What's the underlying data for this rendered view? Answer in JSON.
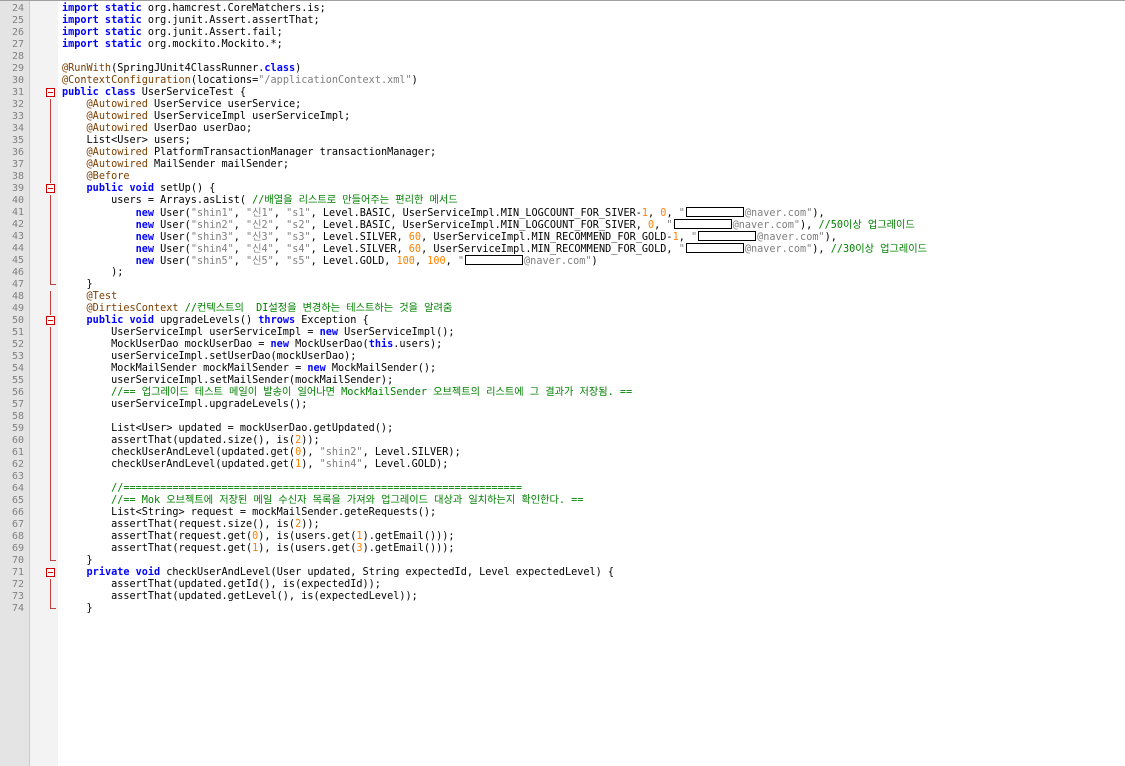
{
  "editor": {
    "lines": [
      {
        "n": "24",
        "fold": "",
        "segs": [
          {
            "t": "kw",
            "v": "import static"
          },
          {
            "t": "",
            "v": " org.hamcrest.CoreMatchers.is;"
          }
        ]
      },
      {
        "n": "25",
        "fold": "",
        "segs": [
          {
            "t": "kw",
            "v": "import static"
          },
          {
            "t": "",
            "v": " org.junit.Assert.assertThat;"
          }
        ]
      },
      {
        "n": "26",
        "fold": "",
        "segs": [
          {
            "t": "kw",
            "v": "import static"
          },
          {
            "t": "",
            "v": " org.junit.Assert.fail;"
          }
        ]
      },
      {
        "n": "27",
        "fold": "",
        "segs": [
          {
            "t": "kw",
            "v": "import static"
          },
          {
            "t": "",
            "v": " org.mockito.Mockito.*;"
          }
        ]
      },
      {
        "n": "28",
        "fold": "",
        "segs": []
      },
      {
        "n": "29",
        "fold": "",
        "segs": [
          {
            "t": "ann",
            "v": "@RunWith"
          },
          {
            "t": "",
            "v": "(SpringJUnit4ClassRunner."
          },
          {
            "t": "kw",
            "v": "class"
          },
          {
            "t": "",
            "v": ")"
          }
        ]
      },
      {
        "n": "30",
        "fold": "",
        "segs": [
          {
            "t": "ann",
            "v": "@ContextConfiguration"
          },
          {
            "t": "",
            "v": "(locations="
          },
          {
            "t": "str",
            "v": "\"/applicationContext.xml\""
          },
          {
            "t": "",
            "v": ")"
          }
        ]
      },
      {
        "n": "31",
        "fold": "box",
        "segs": [
          {
            "t": "kw",
            "v": "public class"
          },
          {
            "t": "",
            "v": " UserServiceTest {"
          }
        ]
      },
      {
        "n": "32",
        "fold": "bar",
        "segs": [
          {
            "t": "",
            "v": "    "
          },
          {
            "t": "ann",
            "v": "@Autowired"
          },
          {
            "t": "",
            "v": " UserService userService;"
          }
        ]
      },
      {
        "n": "33",
        "fold": "bar",
        "segs": [
          {
            "t": "",
            "v": "    "
          },
          {
            "t": "ann",
            "v": "@Autowired"
          },
          {
            "t": "",
            "v": " UserServiceImpl userServiceImpl;"
          }
        ]
      },
      {
        "n": "34",
        "fold": "bar",
        "segs": [
          {
            "t": "",
            "v": "    "
          },
          {
            "t": "ann",
            "v": "@Autowired"
          },
          {
            "t": "",
            "v": " UserDao userDao;"
          }
        ]
      },
      {
        "n": "35",
        "fold": "bar",
        "segs": [
          {
            "t": "",
            "v": "    List<User> users;"
          }
        ]
      },
      {
        "n": "36",
        "fold": "bar",
        "segs": [
          {
            "t": "",
            "v": "    "
          },
          {
            "t": "ann",
            "v": "@Autowired"
          },
          {
            "t": "",
            "v": " PlatformTransactionManager transactionManager;"
          }
        ]
      },
      {
        "n": "37",
        "fold": "bar",
        "segs": [
          {
            "t": "",
            "v": "    "
          },
          {
            "t": "ann",
            "v": "@Autowired"
          },
          {
            "t": "",
            "v": " MailSender mailSender;"
          }
        ]
      },
      {
        "n": "38",
        "fold": "bar",
        "segs": [
          {
            "t": "",
            "v": "    "
          },
          {
            "t": "ann",
            "v": "@Before"
          }
        ]
      },
      {
        "n": "39",
        "fold": "box",
        "segs": [
          {
            "t": "",
            "v": "    "
          },
          {
            "t": "kw",
            "v": "public void"
          },
          {
            "t": "",
            "v": " setUp() {"
          }
        ]
      },
      {
        "n": "40",
        "fold": "bar",
        "segs": [
          {
            "t": "",
            "v": "        users = Arrays.asList( "
          },
          {
            "t": "cmt",
            "v": "//배열을 리스트로 만들어주는 편리한 메서드"
          }
        ]
      },
      {
        "n": "41",
        "fold": "bar",
        "segs": [
          {
            "t": "",
            "v": "            "
          },
          {
            "t": "kw",
            "v": "new"
          },
          {
            "t": "",
            "v": " User("
          },
          {
            "t": "str",
            "v": "\"shin1\""
          },
          {
            "t": "",
            "v": ", "
          },
          {
            "t": "str",
            "v": "\"신1\""
          },
          {
            "t": "",
            "v": ", "
          },
          {
            "t": "str",
            "v": "\"s1\""
          },
          {
            "t": "",
            "v": ", Level.BASIC, UserServiceImpl.MIN_LOGCOUNT_FOR_SIVER-"
          },
          {
            "t": "num",
            "v": "1"
          },
          {
            "t": "",
            "v": ", "
          },
          {
            "t": "num",
            "v": "0"
          },
          {
            "t": "",
            "v": ", "
          },
          {
            "t": "str",
            "v": "\""
          },
          {
            "t": "redact",
            "v": ""
          },
          {
            "t": "str",
            "v": "@naver.com\""
          },
          {
            "t": "",
            "v": "),"
          }
        ]
      },
      {
        "n": "42",
        "fold": "bar",
        "segs": [
          {
            "t": "",
            "v": "            "
          },
          {
            "t": "kw",
            "v": "new"
          },
          {
            "t": "",
            "v": " User("
          },
          {
            "t": "str",
            "v": "\"shin2\""
          },
          {
            "t": "",
            "v": ", "
          },
          {
            "t": "str",
            "v": "\"신2\""
          },
          {
            "t": "",
            "v": ", "
          },
          {
            "t": "str",
            "v": "\"s2\""
          },
          {
            "t": "",
            "v": ", Level.BASIC, UserServiceImpl.MIN_LOGCOUNT_FOR_SIVER, "
          },
          {
            "t": "num",
            "v": "0"
          },
          {
            "t": "",
            "v": ", "
          },
          {
            "t": "str",
            "v": "\""
          },
          {
            "t": "redact",
            "v": ""
          },
          {
            "t": "str",
            "v": "@naver.com\""
          },
          {
            "t": "",
            "v": "), "
          },
          {
            "t": "cmt",
            "v": "//50이상 업그레이드"
          }
        ]
      },
      {
        "n": "43",
        "fold": "bar",
        "segs": [
          {
            "t": "",
            "v": "            "
          },
          {
            "t": "kw",
            "v": "new"
          },
          {
            "t": "",
            "v": " User("
          },
          {
            "t": "str",
            "v": "\"shin3\""
          },
          {
            "t": "",
            "v": ", "
          },
          {
            "t": "str",
            "v": "\"신3\""
          },
          {
            "t": "",
            "v": ", "
          },
          {
            "t": "str",
            "v": "\"s3\""
          },
          {
            "t": "",
            "v": ", Level.SILVER, "
          },
          {
            "t": "num",
            "v": "60"
          },
          {
            "t": "",
            "v": ", UserServiceImpl.MIN_RECOMMEND_FOR_GOLD-"
          },
          {
            "t": "num",
            "v": "1"
          },
          {
            "t": "",
            "v": ", "
          },
          {
            "t": "str",
            "v": "\""
          },
          {
            "t": "redact",
            "v": ""
          },
          {
            "t": "str",
            "v": "@naver.com\""
          },
          {
            "t": "",
            "v": "),"
          }
        ]
      },
      {
        "n": "44",
        "fold": "bar",
        "segs": [
          {
            "t": "",
            "v": "            "
          },
          {
            "t": "kw",
            "v": "new"
          },
          {
            "t": "",
            "v": " User("
          },
          {
            "t": "str",
            "v": "\"shin4\""
          },
          {
            "t": "",
            "v": ", "
          },
          {
            "t": "str",
            "v": "\"신4\""
          },
          {
            "t": "",
            "v": ", "
          },
          {
            "t": "str",
            "v": "\"s4\""
          },
          {
            "t": "",
            "v": ", Level.SILVER, "
          },
          {
            "t": "num",
            "v": "60"
          },
          {
            "t": "",
            "v": ", UserServiceImpl.MIN_RECOMMEND_FOR_GOLD, "
          },
          {
            "t": "str",
            "v": "\""
          },
          {
            "t": "redact",
            "v": ""
          },
          {
            "t": "str",
            "v": "@naver.com\""
          },
          {
            "t": "",
            "v": "), "
          },
          {
            "t": "cmt",
            "v": "//30이상 업그레이드"
          }
        ]
      },
      {
        "n": "45",
        "fold": "bar",
        "segs": [
          {
            "t": "",
            "v": "            "
          },
          {
            "t": "kw",
            "v": "new"
          },
          {
            "t": "",
            "v": " User("
          },
          {
            "t": "str",
            "v": "\"shin5\""
          },
          {
            "t": "",
            "v": ", "
          },
          {
            "t": "str",
            "v": "\"신5\""
          },
          {
            "t": "",
            "v": ", "
          },
          {
            "t": "str",
            "v": "\"s5\""
          },
          {
            "t": "",
            "v": ", Level.GOLD, "
          },
          {
            "t": "num",
            "v": "100"
          },
          {
            "t": "",
            "v": ", "
          },
          {
            "t": "num",
            "v": "100"
          },
          {
            "t": "",
            "v": ", "
          },
          {
            "t": "str",
            "v": "\""
          },
          {
            "t": "redact",
            "v": ""
          },
          {
            "t": "str",
            "v": "@naver.com\""
          },
          {
            "t": "",
            "v": ")"
          }
        ]
      },
      {
        "n": "46",
        "fold": "bar",
        "segs": [
          {
            "t": "",
            "v": "        );"
          }
        ]
      },
      {
        "n": "47",
        "fold": "end",
        "segs": [
          {
            "t": "",
            "v": "    }"
          }
        ]
      },
      {
        "n": "48",
        "fold": "bar",
        "segs": [
          {
            "t": "",
            "v": "    "
          },
          {
            "t": "ann",
            "v": "@Test"
          }
        ]
      },
      {
        "n": "49",
        "fold": "bar",
        "segs": [
          {
            "t": "",
            "v": "    "
          },
          {
            "t": "ann",
            "v": "@DirtiesContext"
          },
          {
            "t": "",
            "v": " "
          },
          {
            "t": "cmt",
            "v": "//컨텍스트의  DI설정을 변경하는 테스트하는 것을 알려줌"
          }
        ]
      },
      {
        "n": "50",
        "fold": "box",
        "segs": [
          {
            "t": "",
            "v": "    "
          },
          {
            "t": "kw",
            "v": "public void"
          },
          {
            "t": "",
            "v": " upgradeLevels() "
          },
          {
            "t": "kw",
            "v": "throws"
          },
          {
            "t": "",
            "v": " Exception {"
          }
        ]
      },
      {
        "n": "51",
        "fold": "bar",
        "segs": [
          {
            "t": "",
            "v": "        UserServiceImpl userServiceImpl = "
          },
          {
            "t": "kw",
            "v": "new"
          },
          {
            "t": "",
            "v": " UserServiceImpl();"
          }
        ]
      },
      {
        "n": "52",
        "fold": "bar",
        "segs": [
          {
            "t": "",
            "v": "        MockUserDao mockUserDao = "
          },
          {
            "t": "kw",
            "v": "new"
          },
          {
            "t": "",
            "v": " MockUserDao("
          },
          {
            "t": "kw",
            "v": "this"
          },
          {
            "t": "",
            "v": ".users);"
          }
        ]
      },
      {
        "n": "53",
        "fold": "bar",
        "segs": [
          {
            "t": "",
            "v": "        userServiceImpl.setUserDao(mockUserDao);"
          }
        ]
      },
      {
        "n": "54",
        "fold": "bar",
        "segs": [
          {
            "t": "",
            "v": "        MockMailSender mockMailSender = "
          },
          {
            "t": "kw",
            "v": "new"
          },
          {
            "t": "",
            "v": " MockMailSender();"
          }
        ]
      },
      {
        "n": "55",
        "fold": "bar",
        "segs": [
          {
            "t": "",
            "v": "        userServiceImpl.setMailSender(mockMailSender);"
          }
        ]
      },
      {
        "n": "56",
        "fold": "bar",
        "segs": [
          {
            "t": "",
            "v": "        "
          },
          {
            "t": "cmt",
            "v": "//== 업그레이드 테스트 메일이 발송이 일어나면 MockMailSender 오브젝트의 리스트에 그 결과가 저장됨. =="
          }
        ]
      },
      {
        "n": "57",
        "fold": "bar",
        "segs": [
          {
            "t": "",
            "v": "        userServiceImpl.upgradeLevels();"
          }
        ]
      },
      {
        "n": "58",
        "fold": "bar",
        "segs": []
      },
      {
        "n": "59",
        "fold": "bar",
        "segs": [
          {
            "t": "",
            "v": "        List<User> updated = mockUserDao.getUpdated();"
          }
        ]
      },
      {
        "n": "60",
        "fold": "bar",
        "segs": [
          {
            "t": "",
            "v": "        assertThat(updated.size(), is("
          },
          {
            "t": "num",
            "v": "2"
          },
          {
            "t": "",
            "v": "));"
          }
        ]
      },
      {
        "n": "61",
        "fold": "bar",
        "segs": [
          {
            "t": "",
            "v": "        checkUserAndLevel(updated.get("
          },
          {
            "t": "num",
            "v": "0"
          },
          {
            "t": "",
            "v": "), "
          },
          {
            "t": "str",
            "v": "\"shin2\""
          },
          {
            "t": "",
            "v": ", Level.SILVER);"
          }
        ]
      },
      {
        "n": "62",
        "fold": "bar",
        "segs": [
          {
            "t": "",
            "v": "        checkUserAndLevel(updated.get("
          },
          {
            "t": "num",
            "v": "1"
          },
          {
            "t": "",
            "v": "), "
          },
          {
            "t": "str",
            "v": "\"shin4\""
          },
          {
            "t": "",
            "v": ", Level.GOLD);"
          }
        ]
      },
      {
        "n": "63",
        "fold": "bar",
        "segs": []
      },
      {
        "n": "64",
        "fold": "bar",
        "segs": [
          {
            "t": "",
            "v": "        "
          },
          {
            "t": "cmt",
            "v": "//================================================================="
          }
        ]
      },
      {
        "n": "65",
        "fold": "bar",
        "segs": [
          {
            "t": "",
            "v": "        "
          },
          {
            "t": "cmt",
            "v": "//== Mok 오브젝트에 저장된 메일 수신자 목록을 가져와 업그레이드 대상과 일치하는지 확인한다. =="
          }
        ]
      },
      {
        "n": "66",
        "fold": "bar",
        "segs": [
          {
            "t": "",
            "v": "        List<String> request = mockMailSender.geteRequests();"
          }
        ]
      },
      {
        "n": "67",
        "fold": "bar",
        "segs": [
          {
            "t": "",
            "v": "        assertThat(request.size(), is("
          },
          {
            "t": "num",
            "v": "2"
          },
          {
            "t": "",
            "v": "));"
          }
        ]
      },
      {
        "n": "68",
        "fold": "bar",
        "segs": [
          {
            "t": "",
            "v": "        assertThat(request.get("
          },
          {
            "t": "num",
            "v": "0"
          },
          {
            "t": "",
            "v": "), is(users.get("
          },
          {
            "t": "num",
            "v": "1"
          },
          {
            "t": "",
            "v": ").getEmail()));"
          }
        ]
      },
      {
        "n": "69",
        "fold": "bar",
        "segs": [
          {
            "t": "",
            "v": "        assertThat(request.get("
          },
          {
            "t": "num",
            "v": "1"
          },
          {
            "t": "",
            "v": "), is(users.get("
          },
          {
            "t": "num",
            "v": "3"
          },
          {
            "t": "",
            "v": ").getEmail()));"
          }
        ]
      },
      {
        "n": "70",
        "fold": "end",
        "segs": [
          {
            "t": "",
            "v": "    }"
          }
        ]
      },
      {
        "n": "71",
        "fold": "box",
        "segs": [
          {
            "t": "",
            "v": "    "
          },
          {
            "t": "kw",
            "v": "private void"
          },
          {
            "t": "",
            "v": " checkUserAndLevel(User updated, String expectedId, Level expectedLevel) {"
          }
        ]
      },
      {
        "n": "72",
        "fold": "bar",
        "segs": [
          {
            "t": "",
            "v": "        assertThat(updated.getId(), is(expectedId));"
          }
        ]
      },
      {
        "n": "73",
        "fold": "bar",
        "segs": [
          {
            "t": "",
            "v": "        assertThat(updated.getLevel(), is(expectedLevel));"
          }
        ]
      },
      {
        "n": "74",
        "fold": "end",
        "segs": [
          {
            "t": "",
            "v": "    }"
          }
        ]
      }
    ]
  }
}
